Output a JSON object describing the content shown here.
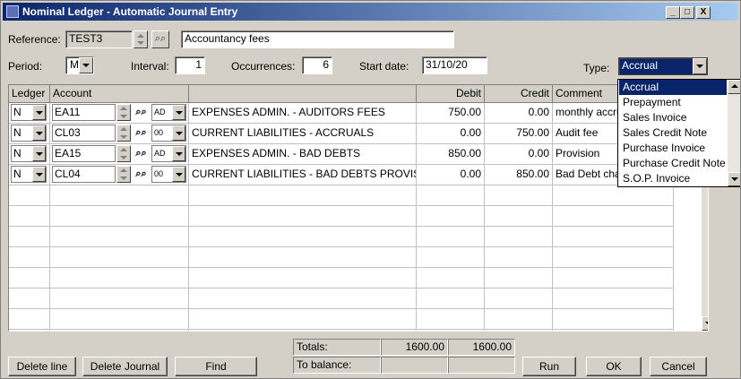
{
  "window": {
    "title": "Nominal Ledger - Automatic Journal Entry",
    "min_glyph": "_",
    "max_glyph": "□",
    "close_glyph": "X"
  },
  "reference": {
    "label": "Reference:",
    "value": "TEST3",
    "description": "Accountancy fees"
  },
  "period": {
    "label": "Period:",
    "value": "M"
  },
  "interval": {
    "label": "Interval:",
    "value": "1"
  },
  "occurrences": {
    "label": "Occurrences:",
    "value": "6"
  },
  "start_date": {
    "label": "Start date:",
    "value": "31/10/20"
  },
  "type": {
    "label": "Type:",
    "value": "Accrual",
    "options": [
      "Accrual",
      "Prepayment",
      "Sales Invoice",
      "Sales Credit Note",
      "Purchase Invoice",
      "Purchase Credit Note",
      "S.O.P. Invoice"
    ]
  },
  "grid": {
    "columns": [
      "Ledger",
      "Account",
      "",
      "Debit",
      "Credit",
      "Comment"
    ],
    "rows": [
      {
        "ledger": "N",
        "account": "EA11",
        "tax": "AD",
        "description": "EXPENSES ADMIN. - AUDITORS FEES",
        "debit": "750.00",
        "credit": "0.00",
        "comment": "monthly accru"
      },
      {
        "ledger": "N",
        "account": "CL03",
        "tax": "00",
        "description": "CURRENT LIABILITIES - ACCRUALS",
        "debit": "0.00",
        "credit": "750.00",
        "comment": "Audit fee"
      },
      {
        "ledger": "N",
        "account": "EA15",
        "tax": "AD",
        "description": "EXPENSES ADMIN. - BAD DEBTS",
        "debit": "850.00",
        "credit": "0.00",
        "comment": "Provision"
      },
      {
        "ledger": "N",
        "account": "CL04",
        "tax": "00",
        "description": "CURRENT LIABILITIES - BAD DEBTS PROVIS",
        "debit": "0.00",
        "credit": "850.00",
        "comment": "Bad Debt cha"
      }
    ]
  },
  "totals": {
    "label": "Totals:",
    "debit": "1600.00",
    "credit": "1600.00",
    "balance_label": "To balance:"
  },
  "buttons": {
    "delete_line": "Delete line",
    "delete_journal": "Delete Journal",
    "find": "Find",
    "run": "Run",
    "ok": "OK",
    "cancel": "Cancel"
  }
}
